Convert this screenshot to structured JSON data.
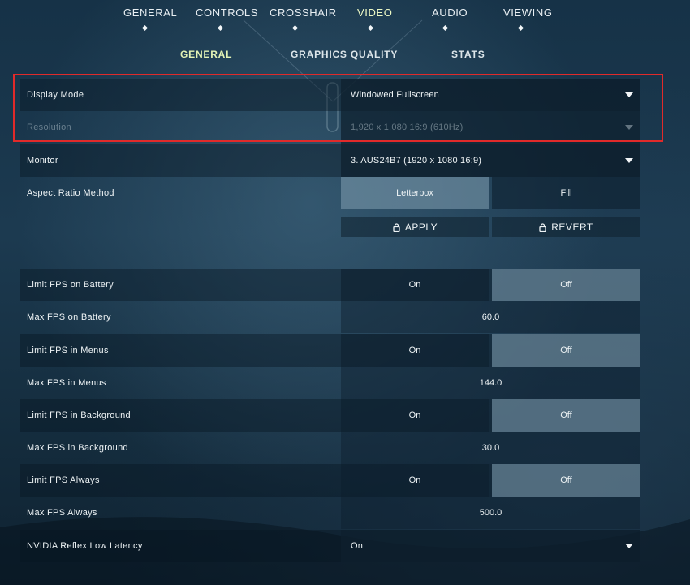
{
  "nav": {
    "tabs": [
      {
        "label": "GENERAL"
      },
      {
        "label": "CONTROLS"
      },
      {
        "label": "CROSSHAIR"
      },
      {
        "label": "VIDEO"
      },
      {
        "label": "AUDIO"
      },
      {
        "label": "VIEWING"
      }
    ],
    "active_tab": "VIDEO"
  },
  "subnav": {
    "tabs": [
      {
        "label": "GENERAL"
      },
      {
        "label": "GRAPHICS QUALITY"
      },
      {
        "label": "STATS"
      }
    ],
    "active_tab": "GENERAL"
  },
  "settings": {
    "display_mode": {
      "label": "Display Mode",
      "value": "Windowed Fullscreen"
    },
    "resolution": {
      "label": "Resolution",
      "value": "1,920 x 1,080 16:9 (610Hz)"
    },
    "monitor": {
      "label": "Monitor",
      "value": "3. AUS24B7 (1920 x  1080 16:9)"
    },
    "aspect_ratio": {
      "label": "Aspect Ratio Method",
      "option_a": "Letterbox",
      "option_b": "Fill",
      "selected": "Letterbox"
    },
    "apply_label": "APPLY",
    "revert_label": "REVERT",
    "limit_fps_battery": {
      "label": "Limit FPS on Battery",
      "on": "On",
      "off": "Off",
      "selected": "Off"
    },
    "max_fps_battery": {
      "label": "Max FPS on Battery",
      "value": "60.0"
    },
    "limit_fps_menus": {
      "label": "Limit FPS in Menus",
      "on": "On",
      "off": "Off",
      "selected": "Off"
    },
    "max_fps_menus": {
      "label": "Max FPS in Menus",
      "value": "144.0"
    },
    "limit_fps_background": {
      "label": "Limit FPS in Background",
      "on": "On",
      "off": "Off",
      "selected": "Off"
    },
    "max_fps_background": {
      "label": "Max FPS in Background",
      "value": "30.0"
    },
    "limit_fps_always": {
      "label": "Limit FPS Always",
      "on": "On",
      "off": "Off",
      "selected": "Off"
    },
    "max_fps_always": {
      "label": "Max FPS Always",
      "value": "500.0"
    },
    "nvidia_reflex": {
      "label": "NVIDIA Reflex Low Latency",
      "value": "On"
    }
  },
  "colors": {
    "highlight_border": "#e12a2a",
    "active_tab_text": "#ebf7c4"
  },
  "icons": {
    "apply": "lock-icon",
    "revert": "lock-icon",
    "dropdown": "caret-down-icon"
  }
}
